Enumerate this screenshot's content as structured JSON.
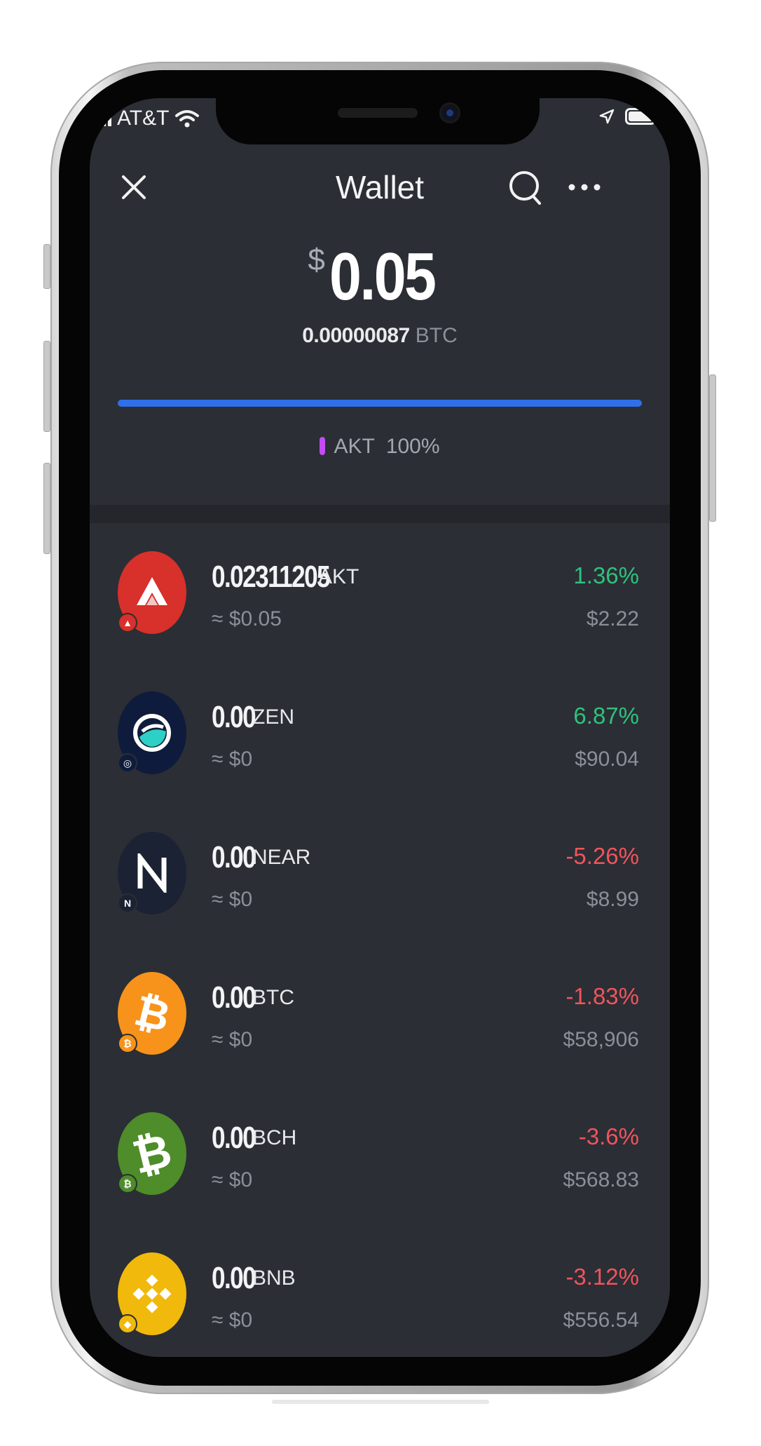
{
  "status_bar": {
    "carrier": "AT&T"
  },
  "nav": {
    "title": "Wallet"
  },
  "balance": {
    "currency_symbol": "$",
    "amount": "0.05",
    "btc_value": "0.00000087",
    "btc_unit": "BTC"
  },
  "allocation": {
    "bar_color": "#2f6fea",
    "legend": [
      {
        "symbol": "AKT",
        "percent": "100%",
        "color": "#c14cf0",
        "share": 1.0
      }
    ]
  },
  "assets": [
    {
      "quantity": "0.02311205",
      "symbol": "AKT",
      "fiat_value": "≈ $0.05",
      "change": "1.36%",
      "direction": "up",
      "price": "$2.22",
      "icon": "akash-logo-icon",
      "color": "#d8302a"
    },
    {
      "quantity": "0.00",
      "symbol": "ZEN",
      "fiat_value": "≈ $0",
      "change": "6.87%",
      "direction": "up",
      "price": "$90.04",
      "icon": "horizen-logo-icon",
      "color": "#0e1b3c"
    },
    {
      "quantity": "0.00",
      "symbol": "NEAR",
      "fiat_value": "≈ $0",
      "change": "-5.26%",
      "direction": "down",
      "price": "$8.99",
      "icon": "near-logo-icon",
      "color": "#1a2233"
    },
    {
      "quantity": "0.00",
      "symbol": "BTC",
      "fiat_value": "≈ $0",
      "change": "-1.83%",
      "direction": "down",
      "price": "$58,906",
      "icon": "bitcoin-logo-icon",
      "color": "#f7931a"
    },
    {
      "quantity": "0.00",
      "symbol": "BCH",
      "fiat_value": "≈ $0",
      "change": "-3.6%",
      "direction": "down",
      "price": "$568.83",
      "icon": "bitcoin-cash-logo-icon",
      "color": "#4e8d2a"
    },
    {
      "quantity": "0.00",
      "symbol": "BNB",
      "fiat_value": "≈ $0",
      "change": "-3.12%",
      "direction": "down",
      "price": "$556.54",
      "icon": "bnb-logo-icon",
      "color": "#f0b90b"
    }
  ],
  "colors": {
    "background": "#2b2e35",
    "positive": "#2fc27b",
    "negative": "#f0545c"
  }
}
